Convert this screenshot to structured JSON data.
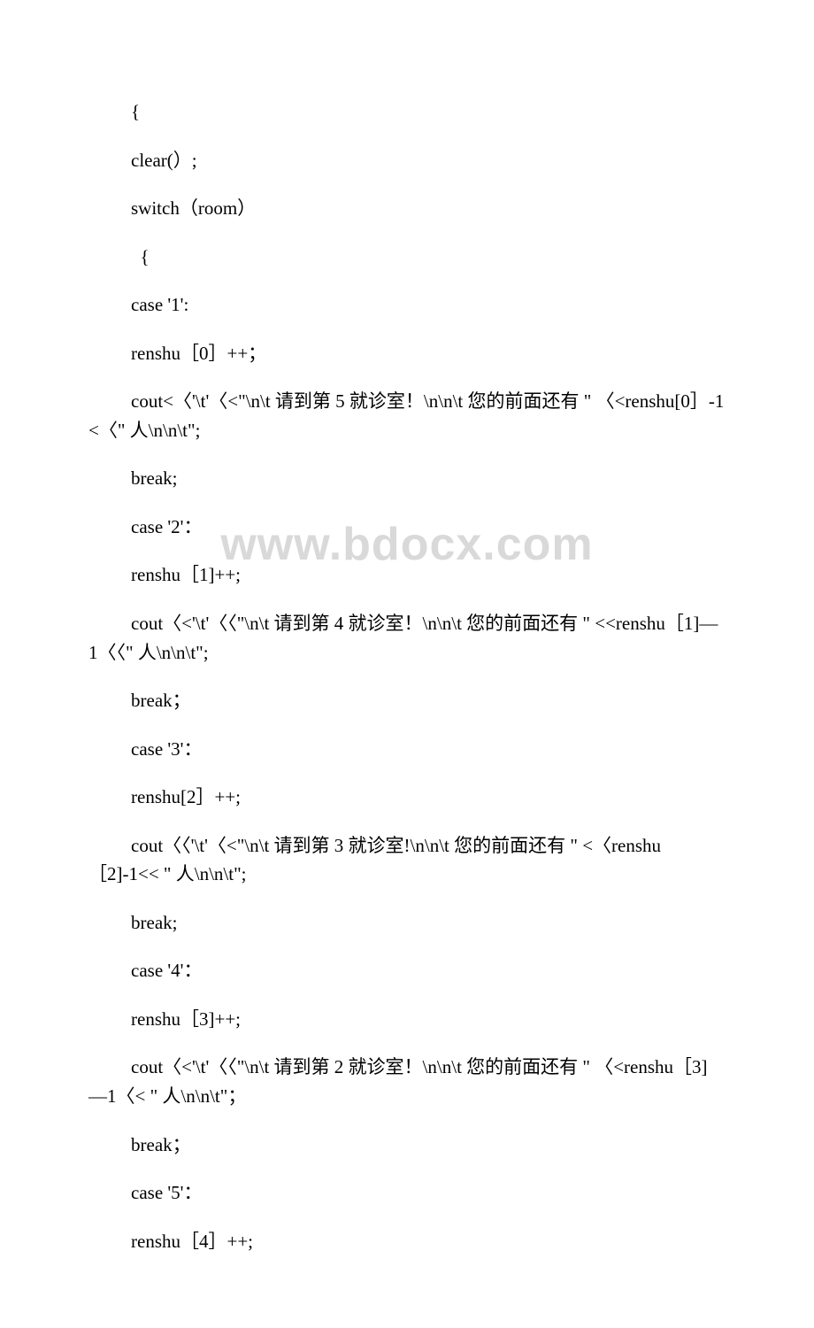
{
  "watermark": "www.bdocx.com",
  "lines": [
    "{",
    "clear(）;",
    "switch（room）",
    "  {",
    "case '1':",
    "renshu［0］++；",
    "cout<〈'\\t'〈<\"\\n\\t 请到第 5 就诊室！\\n\\n\\t 您的前面还有 \" 〈<renshu[0］-1 <〈\" 人\\n\\n\\t\";",
    "break;",
    "case '2'：",
    "renshu［1]++;",
    "cout〈<'\\t'〈〈\"\\n\\t 请到第 4 就诊室！\\n\\n\\t 您的前面还有 \" <<renshu［1]—1〈〈\" 人\\n\\n\\t\";",
    "break；",
    "case '3'：",
    "renshu[2］++;",
    "cout〈〈'\\t'〈<\"\\n\\t 请到第 3 就诊室!\\n\\n\\t 您的前面还有 \" <〈renshu［2]-1<< \" 人\\n\\n\\t\";",
    "break;",
    "case '4'：",
    "renshu［3]++;",
    "cout〈<'\\t'〈〈\"\\n\\t 请到第 2 就诊室！\\n\\n\\t 您的前面还有 \" 〈<renshu［3]—1〈< \" 人\\n\\n\\t\"；",
    "break；",
    "case '5'：",
    "renshu［4］++;"
  ]
}
